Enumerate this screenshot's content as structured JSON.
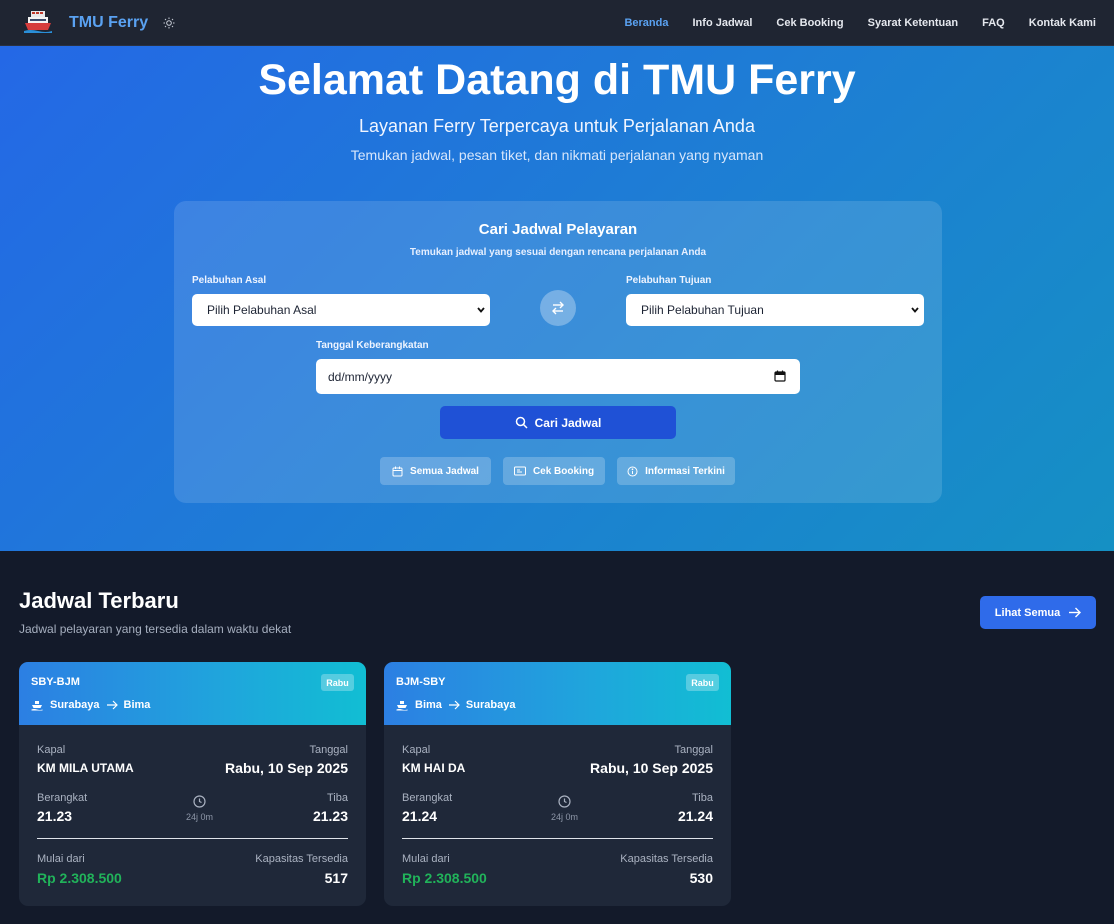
{
  "nav": {
    "brand": "TMU Ferry",
    "links": [
      "Beranda",
      "Info Jadwal",
      "Cek Booking",
      "Syarat Ketentuan",
      "FAQ",
      "Kontak Kami"
    ],
    "active": "Beranda"
  },
  "hero": {
    "title": "Selamat Datang di TMU Ferry",
    "subtitle": "Layanan Ferry Terpercaya untuk Perjalanan Anda",
    "description": "Temukan jadwal, pesan tiket, dan nikmati perjalanan yang nyaman"
  },
  "search": {
    "title": "Cari Jadwal Pelayaran",
    "subtitle": "Temukan jadwal yang sesuai dengan rencana perjalanan Anda",
    "origin_label": "Pelabuhan Asal",
    "origin_value": "Pilih Pelabuhan Asal",
    "destination_label": "Pelabuhan Tujuan",
    "destination_value": "Pilih Pelabuhan Tujuan",
    "date_label": "Tanggal Keberangkatan",
    "date_placeholder": "dd/mm/yyyy",
    "search_button": "Cari Jadwal",
    "quick_links": [
      "Semua Jadwal",
      "Cek Booking",
      "Informasi Terkini"
    ]
  },
  "schedules": {
    "title": "Jadwal Terbaru",
    "subtitle": "Jadwal pelayaran yang tersedia dalam waktu dekat",
    "see_all": "Lihat Semua",
    "labels": {
      "ship": "Kapal",
      "date": "Tanggal",
      "depart": "Berangkat",
      "arrive": "Tiba",
      "price_from": "Mulai dari",
      "capacity": "Kapasitas Tersedia"
    },
    "cards": [
      {
        "code": "SBY-BJM",
        "day": "Rabu",
        "from": "Surabaya",
        "to": "Bima",
        "ship": "KM MILA UTAMA",
        "date": "Rabu, 10 Sep 2025",
        "depart": "21.23",
        "duration": "24j 0m",
        "arrive": "21.23",
        "price": "Rp 2.308.500",
        "capacity": "517"
      },
      {
        "code": "BJM-SBY",
        "day": "Rabu",
        "from": "Bima",
        "to": "Surabaya",
        "ship": "KM HAI DA",
        "date": "Rabu, 10 Sep 2025",
        "depart": "21.24",
        "duration": "24j 0m",
        "arrive": "21.24",
        "price": "Rp 2.308.500",
        "capacity": "530"
      }
    ]
  },
  "colors": {
    "brand": "#5aa2f2",
    "primary_button": "#1f51d6",
    "price": "#21b35a",
    "background": "#131a2a"
  }
}
